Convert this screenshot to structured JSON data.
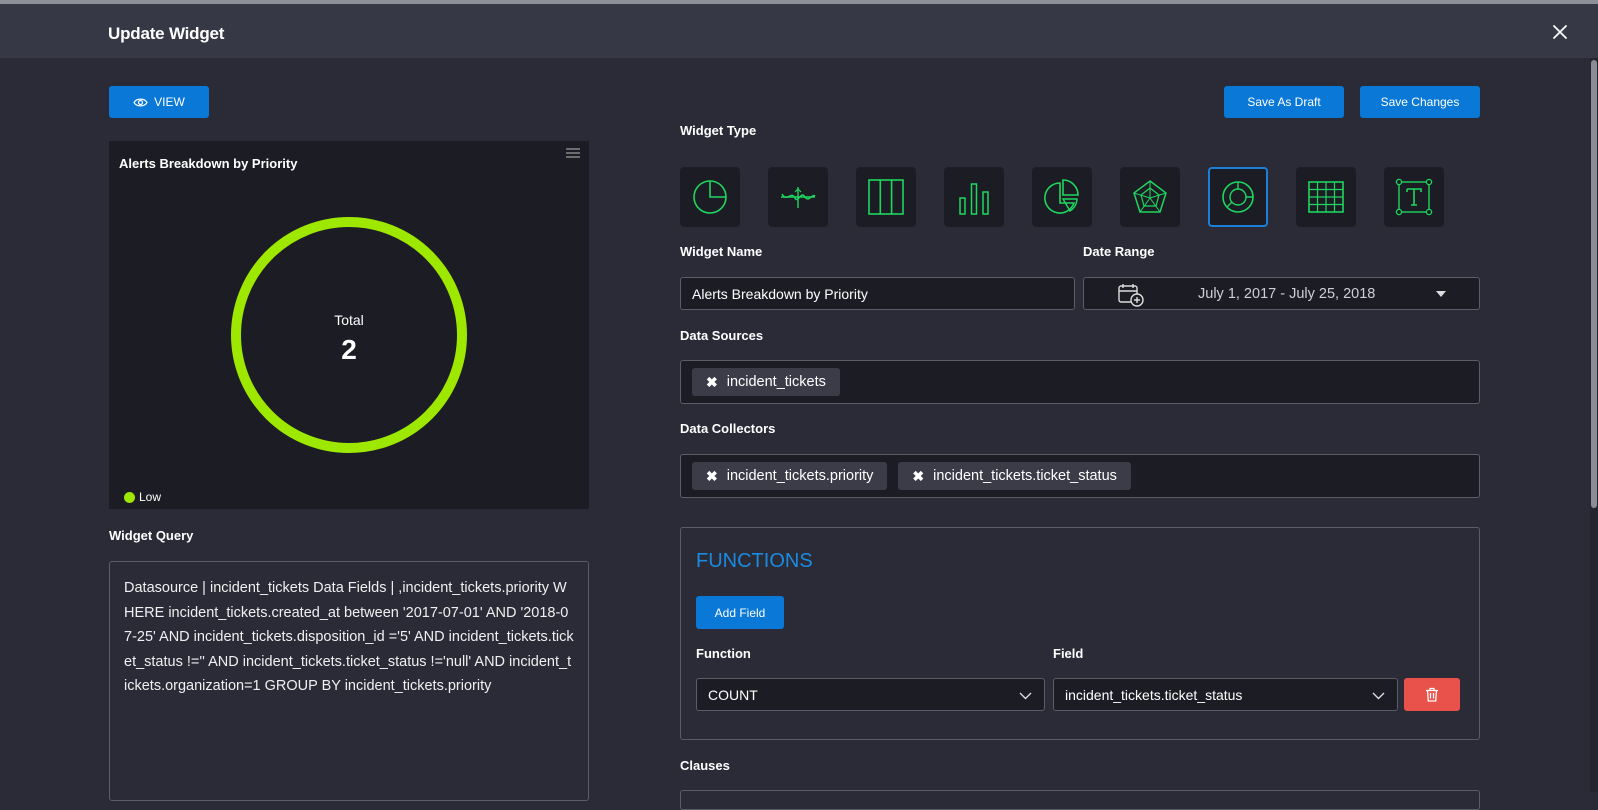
{
  "header": {
    "title": "Update Widget"
  },
  "toolbar": {
    "view_label": "VIEW",
    "save_draft_label": "Save As Draft",
    "save_changes_label": "Save Changes"
  },
  "preview": {
    "chart_title": "Alerts Breakdown by Priority",
    "center_label": "Total",
    "center_value": "2",
    "legend": "Low"
  },
  "chart_data": {
    "type": "pie",
    "title": "Alerts Breakdown by Priority",
    "categories": [
      "Low"
    ],
    "values": [
      2
    ],
    "total": 2,
    "colors": [
      "#9ee800"
    ],
    "legend_placement": "bottom-left"
  },
  "query": {
    "label": "Widget Query",
    "text": "Datasource | incident_tickets Data Fields | ,incident_tickets.priority WHERE incident_tickets.created_at between '2017-07-01' AND '2018-07-25' AND incident_tickets.disposition_id ='5' AND incident_tickets.ticket_status !='' AND incident_tickets.ticket_status !='null' AND incident_tickets.organization=1 GROUP BY incident_tickets.priority"
  },
  "widget_type": {
    "label": "Widget Type",
    "types": [
      "pie",
      "line",
      "column",
      "bar",
      "pie-split",
      "radar",
      "donut",
      "table",
      "text"
    ],
    "selected": "donut",
    "accent": "#1fd65f"
  },
  "widget_name": {
    "label": "Widget Name",
    "value": "Alerts Breakdown by Priority"
  },
  "date_range": {
    "label": "Date Range",
    "value": "July 1, 2017 - July 25, 2018"
  },
  "data_sources": {
    "label": "Data Sources",
    "tags": [
      "incident_tickets"
    ]
  },
  "data_collectors": {
    "label": "Data Collectors",
    "tags": [
      "incident_tickets.priority",
      "incident_tickets.ticket_status"
    ]
  },
  "functions": {
    "title": "FUNCTIONS",
    "add_field_label": "Add Field",
    "function_label": "Function",
    "field_label": "Field",
    "function_value": "COUNT",
    "field_value": "incident_tickets.ticket_status"
  },
  "clauses": {
    "label": "Clauses"
  },
  "colors": {
    "primary": "#0a78d6",
    "danger": "#e9524a",
    "series_low": "#9ee800"
  }
}
